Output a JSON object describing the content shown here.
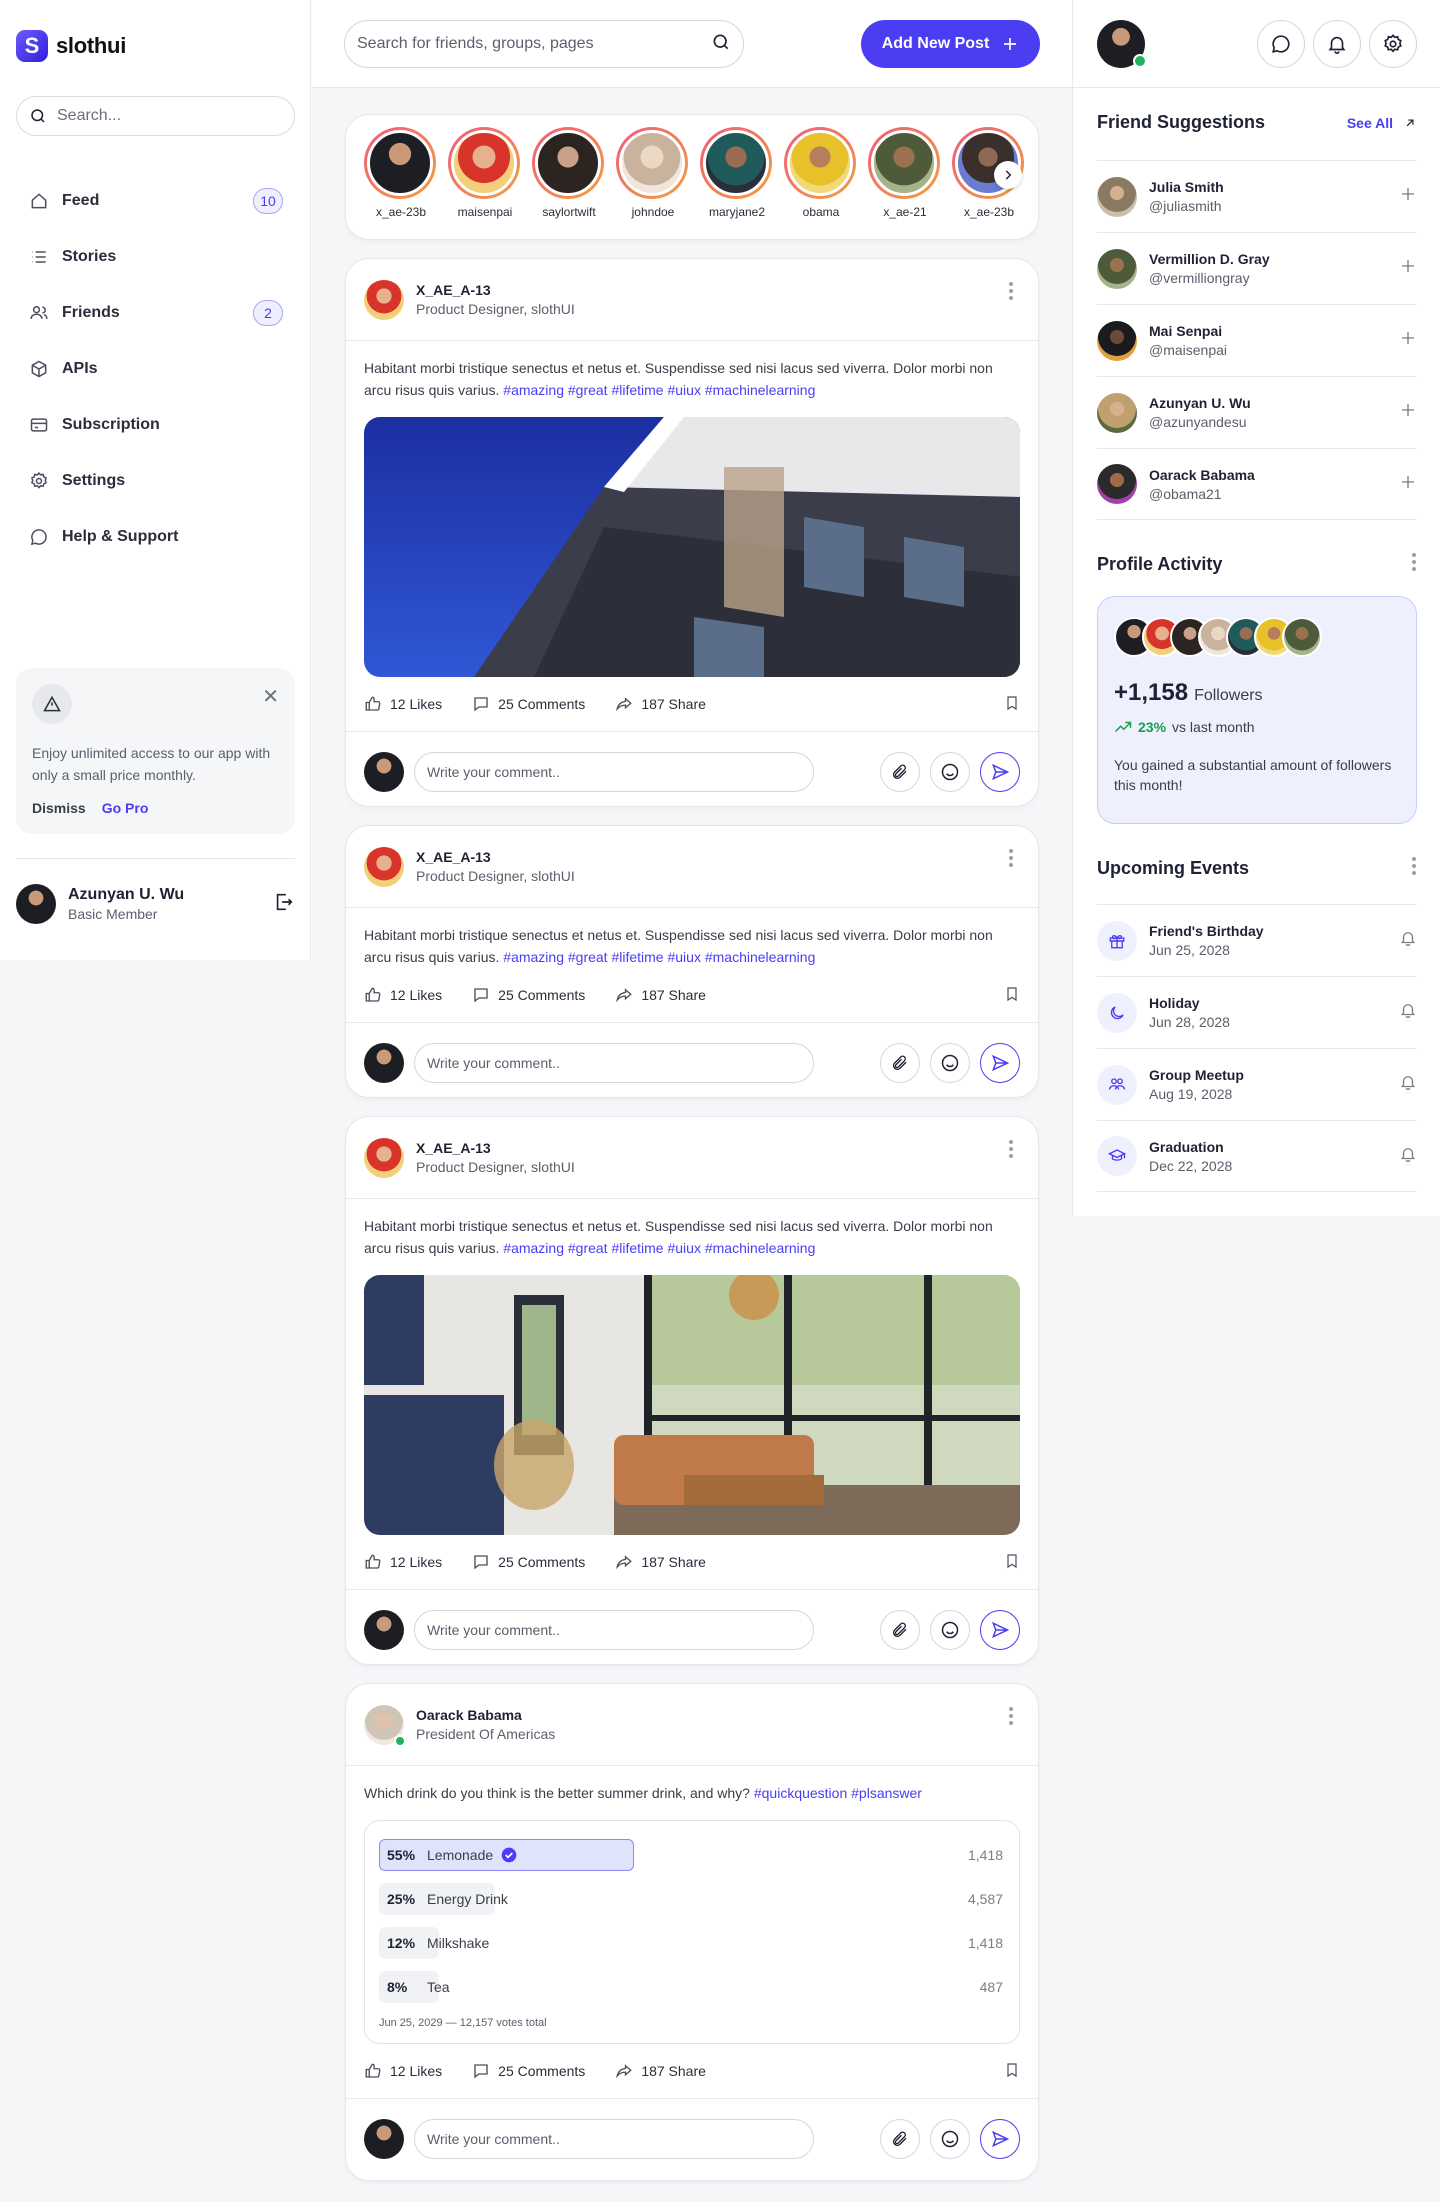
{
  "brand": {
    "name": "slothui",
    "mark": "S"
  },
  "sidebar": {
    "search_placeholder": "Search...",
    "items": [
      {
        "label": "Feed",
        "icon": "home-icon",
        "badge": "10"
      },
      {
        "label": "Stories",
        "icon": "list-icon",
        "badge": ""
      },
      {
        "label": "Friends",
        "icon": "users-icon",
        "badge": "2"
      },
      {
        "label": "APIs",
        "icon": "cube-icon",
        "badge": ""
      },
      {
        "label": "Subscription",
        "icon": "card-icon",
        "badge": ""
      },
      {
        "label": "Settings",
        "icon": "gear-icon",
        "badge": ""
      },
      {
        "label": "Help & Support",
        "icon": "chat-icon",
        "badge": ""
      }
    ],
    "promo": {
      "text": "Enjoy unlimited access to our app with only a small price monthly.",
      "dismiss": "Dismiss",
      "go_pro": "Go Pro"
    },
    "user": {
      "name": "Azunyan U. Wu",
      "role": "Basic Member"
    }
  },
  "header": {
    "search_placeholder": "Search for friends, groups, pages",
    "add_post": "Add New Post"
  },
  "stories": [
    "x_ae-23b",
    "maisenpai",
    "saylortwift",
    "johndoe",
    "maryjane2",
    "obama",
    "x_ae-21",
    "x_ae-23b"
  ],
  "posts": [
    {
      "author": "X_AE_A-13",
      "role": "Product Designer, slothUI",
      "text": "Habitant morbi tristique senectus et netus et. Suspendisse sed nisi lacus sed viverra. Dolor morbi non arcu risus quis varius. ",
      "tags": "#amazing #great #lifetime #uiux #machinelearning",
      "likes": "12 Likes",
      "comments": "25 Comments",
      "shares": "187 Share",
      "comment_placeholder": "Write your comment.."
    },
    {
      "author": "X_AE_A-13",
      "role": "Product Designer, slothUI",
      "text": "Habitant morbi tristique senectus et netus et. Suspendisse sed nisi lacus sed viverra. Dolor morbi non arcu risus quis varius. ",
      "tags": "#amazing #great #lifetime #uiux #machinelearning",
      "likes": "12 Likes",
      "comments": "25 Comments",
      "shares": "187 Share",
      "comment_placeholder": "Write your comment.."
    },
    {
      "author": "X_AE_A-13",
      "role": "Product Designer, slothUI",
      "text": "Habitant morbi tristique senectus et netus et. Suspendisse sed nisi lacus sed viverra. Dolor morbi non arcu risus quis varius. ",
      "tags": "#amazing #great #lifetime #uiux #machinelearning",
      "likes": "12 Likes",
      "comments": "25 Comments",
      "shares": "187 Share",
      "comment_placeholder": "Write your comment.."
    },
    {
      "author": "Oarack Babama",
      "role": "President Of Americas",
      "text": "Which drink do you think is the better summer drink, and why? ",
      "tags": "#quickquestion #plsanswer",
      "likes": "12 Likes",
      "comments": "25 Comments",
      "shares": "187 Share",
      "comment_placeholder": "Write your comment.."
    }
  ],
  "poll": {
    "options": [
      {
        "pct": "55%",
        "value": 0.55,
        "label": "Lemonade",
        "count": "1,418",
        "selected": true
      },
      {
        "pct": "25%",
        "value": 0.25,
        "label": "Energy Drink",
        "count": "4,587",
        "selected": false
      },
      {
        "pct": "12%",
        "value": 0.12,
        "label": "Milkshake",
        "count": "1,418",
        "selected": false
      },
      {
        "pct": "8%",
        "value": 0.08,
        "label": "Tea",
        "count": "487",
        "selected": false
      }
    ],
    "footer": "Jun 25, 2029 — 12,157 votes total"
  },
  "right": {
    "suggestions_title": "Friend Suggestions",
    "see_all": "See All",
    "suggestions": [
      {
        "name": "Julia Smith",
        "handle": "@juliasmith"
      },
      {
        "name": "Vermillion D. Gray",
        "handle": "@vermilliongray"
      },
      {
        "name": "Mai Senpai",
        "handle": "@maisenpai"
      },
      {
        "name": "Azunyan U. Wu",
        "handle": "@azunyandesu"
      },
      {
        "name": "Oarack Babama",
        "handle": "@obama21"
      }
    ],
    "activity_title": "Profile Activity",
    "activity": {
      "count": "+1,158",
      "count_label": "Followers",
      "trend_pct": "23%",
      "trend_label": "vs last month",
      "desc": "You gained a substantial amount of followers this month!"
    },
    "events_title": "Upcoming Events",
    "events": [
      {
        "name": "Friend's Birthday",
        "date": "Jun 25, 2028",
        "icon": "gift-icon"
      },
      {
        "name": "Holiday",
        "date": "Jun 28, 2028",
        "icon": "moon-icon"
      },
      {
        "name": "Group Meetup",
        "date": "Aug 19, 2028",
        "icon": "group-icon"
      },
      {
        "name": "Graduation",
        "date": "Dec 22, 2028",
        "icon": "graduation-cap-icon"
      }
    ]
  },
  "colors": {
    "accent": "#4a3df2",
    "online": "#22b35c",
    "trend": "#1c9c4c"
  }
}
